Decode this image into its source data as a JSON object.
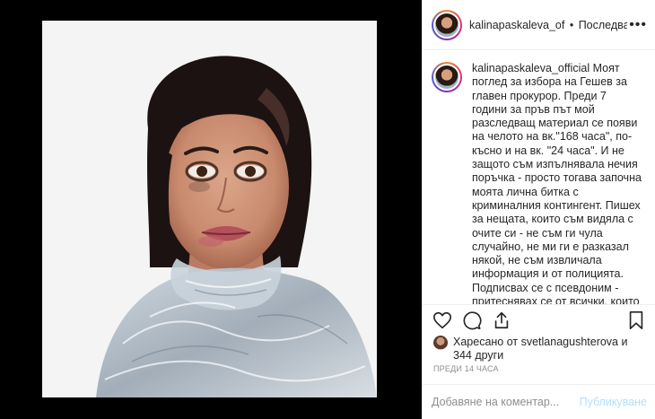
{
  "post": {
    "username": "kalinapaskaleva_of",
    "separator": "•",
    "follow_status": "Последвано",
    "more_label": "•••"
  },
  "caption": {
    "username": "kalinapaskaleva_official",
    "text": " Моят поглед за избора на Гешев за главен прокурор. Преди 7 години за пръв път мой разследващ материал се появи на челото на вк.\"168 часа\", по-късно и на вк. \"24 часа\". И не защото съм изпълнявала нечия поръчка - просто тогава започна моята лична битка с криминалния контингент. Пишех за нещата, които съм видяла с очите си - не съм ги чула случайно, не ми ги е разказал някой, не съм извличала информация и от полицията. Подписвах се с псевдоним - притеснявах се от всички, които с днешна дата са заключени или мъртви. Имаше и заведено дело"
  },
  "likes": {
    "prefix": "Харесано от ",
    "user": "svetlanagushterova",
    "middle": " и",
    "others": "344 други"
  },
  "timestamp": "ПРЕДИ 14 ЧАСА",
  "comment_box": {
    "placeholder": "Добавяне на коментар...",
    "publish_label": "Публикуване"
  },
  "colors": {
    "background": "#000000",
    "panel": "#ffffff",
    "text": "#262626",
    "muted": "#8e8e8e",
    "publish_disabled": "#b2dffc",
    "border": "#efefef"
  },
  "icons": [
    "more-options-icon",
    "heart-icon",
    "comment-icon",
    "share-icon",
    "bookmark-icon"
  ]
}
